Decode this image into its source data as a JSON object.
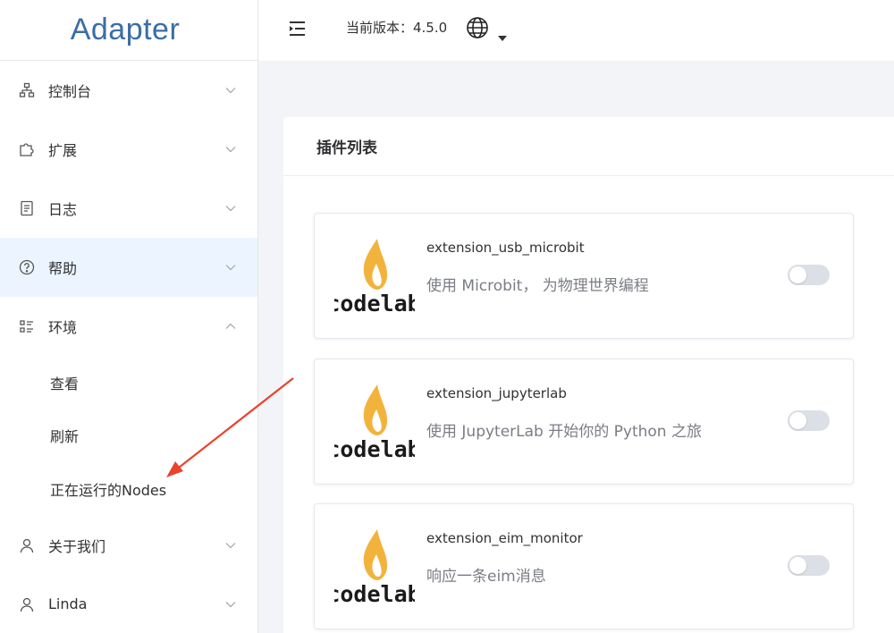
{
  "app": {
    "title": "Adapter"
  },
  "header": {
    "version_text": "当前版本：4.5.0",
    "globe_icon": "globe-icon",
    "fold_icon": "menu-fold-icon"
  },
  "sidebar": {
    "items": [
      {
        "label": "控制台",
        "icon": "sitemap-icon",
        "expanded": false,
        "active": false
      },
      {
        "label": "扩展",
        "icon": "puzzle-icon",
        "expanded": false,
        "active": false
      },
      {
        "label": "日志",
        "icon": "document-icon",
        "expanded": false,
        "active": false
      },
      {
        "label": "帮助",
        "icon": "question-circle-icon",
        "expanded": false,
        "active": true
      },
      {
        "label": "环境",
        "icon": "list-icon",
        "expanded": true,
        "active": false
      },
      {
        "label": "关于我们",
        "icon": "user-icon",
        "expanded": false,
        "active": false
      },
      {
        "label": "Linda",
        "icon": "user-icon",
        "expanded": false,
        "active": false
      }
    ],
    "env_submenu": [
      "查看",
      "刷新",
      "正在运行的Nodes"
    ]
  },
  "main": {
    "card_title": "插件列表",
    "plugins": [
      {
        "name": "extension_usb_microbit",
        "description": "使用 Microbit， 为物理世界编程",
        "logo_text": "codelab",
        "enabled": false
      },
      {
        "name": "extension_jupyterlab",
        "description": "使用 JupyterLab 开始你的 Python 之旅",
        "logo_text": "codelab",
        "enabled": false
      },
      {
        "name": "extension_eim_monitor",
        "description": "响应一条eim消息",
        "logo_text": "codelab",
        "enabled": false
      }
    ]
  },
  "colors": {
    "brand": "#3a6ea5",
    "active_bg": "#ecf5ff",
    "page_bg": "#f2f4f7",
    "toggle_off": "#dcdfe6",
    "flame_outer": "#f2b33d",
    "flame_inner": "#ffffff",
    "annotation_arrow": "#e8432e"
  }
}
